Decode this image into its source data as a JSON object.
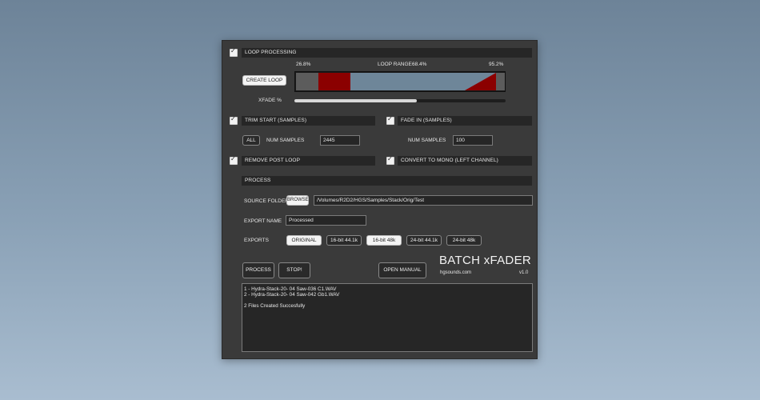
{
  "loop": {
    "title": "LOOP PROCESSING",
    "start_pct": "26.8%",
    "range_label": "LOOP RANGE",
    "range_value": "68.4%",
    "end_pct": "95.2%",
    "create_loop_label": "CREATE LOOP",
    "xfade_label": "XFADE %",
    "xfade_value": 0.58,
    "colors": {
      "waveform_bg": "#5a5a5a",
      "loop_region": "#6e8699",
      "fade_marker": "#8b0000"
    }
  },
  "trim": {
    "title": "TRIM START (SAMPLES)",
    "all_label": "ALL",
    "num_label": "NUM SAMPLES",
    "value": "2445"
  },
  "fade_in": {
    "title": "FADE IN (SAMPLES)",
    "num_label": "NUM SAMPLES",
    "value": "100"
  },
  "remove_post_loop": {
    "title": "REMOVE POST LOOP"
  },
  "mono": {
    "title": "CONVERT TO MONO (LEFT CHANNEL)"
  },
  "process": {
    "title": "PROCESS",
    "source_label": "SOURCE FOLDER",
    "browse_label": "BROWSE",
    "source_path": "/Volumes/R2D2/HGS/Samples/Stack/Orig/Test",
    "export_name_label": "EXPORT NAME",
    "export_name_value": "Processed",
    "exports_label": "EXPORTS",
    "exports": [
      "ORIGINAL",
      "16-bit 44.1k",
      "16-bit 48k",
      "24-bit 44.1k",
      "24-bit 48k"
    ]
  },
  "actions": {
    "process_label": "PROCESS",
    "stop_label": "STOP!",
    "manual_label": "OPEN MANUAL"
  },
  "brand": {
    "title": "BATCH xFADER",
    "site": "hgsounds.com",
    "version": "v1.0"
  },
  "log": {
    "lines": [
      "1 - Hydra-Stack-20- 04 Saw-036 C1.WAV",
      "2 - Hydra-Stack-20- 04 Saw-042 Gb1.WAV",
      "",
      "2 Files Created Succesfully"
    ]
  }
}
